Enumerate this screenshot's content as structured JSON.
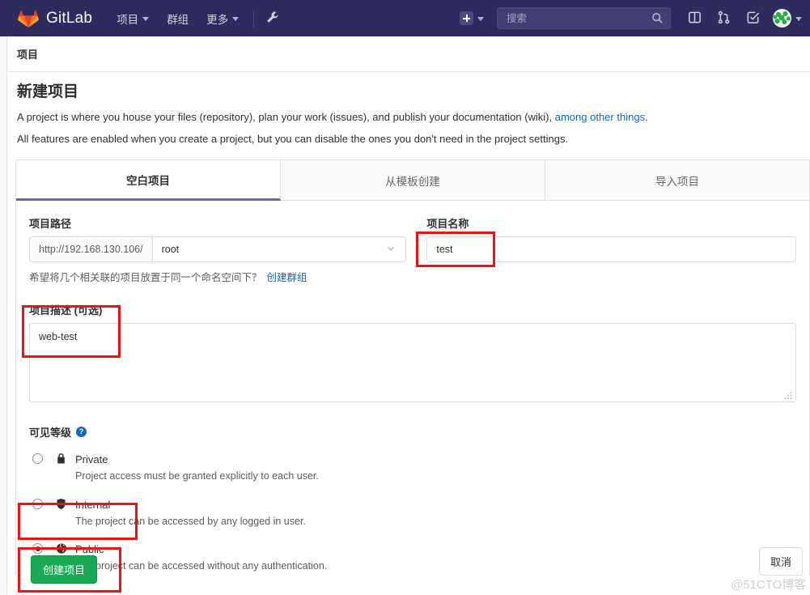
{
  "navbar": {
    "brand": "GitLab",
    "logo_icon": "gitlab-fox-logo",
    "links": [
      {
        "label": "项目",
        "icon": "chevron-down-icon"
      },
      {
        "label": "群组",
        "icon": ""
      },
      {
        "label": "更多",
        "icon": "chevron-down-icon"
      }
    ],
    "admin_icon": "wrench-icon",
    "new_icon": "plus-square-icon",
    "new_caret_icon": "chevron-down-icon",
    "search": {
      "placeholder": "搜索",
      "value": "",
      "icon": "search-icon"
    },
    "issues_icon": "issues-icon",
    "merge_requests_icon": "merge-request-icon",
    "todos_icon": "todo-check-icon",
    "avatar_icon": "user-avatar",
    "avatar_caret_icon": "chevron-down-icon"
  },
  "breadcrumb": {
    "label": "项目"
  },
  "page": {
    "title": "新建项目",
    "desc1_pre": "A project is where you house your files (repository), plan your work (issues), and publish your documentation (wiki), ",
    "desc1_link": "among other things",
    "desc1_post": ".",
    "desc2": "All features are enabled when you create a project, but you can disable the ones you don't need in the project settings."
  },
  "tabs": [
    {
      "label": "空白项目",
      "active": true
    },
    {
      "label": "从模板创建",
      "active": false
    },
    {
      "label": "导入项目",
      "active": false
    }
  ],
  "form": {
    "path_label": "项目路径",
    "path_prefix": "http://192.168.130.106/",
    "namespace_value": "root",
    "namespace_caret_icon": "chevron-down-icon",
    "helper_text": "希望将几个相关联的项目放置于同一个命名空间下？",
    "helper_link": "创建群组",
    "name_label": "项目名称",
    "name_value": "test",
    "desc_label": "项目描述 (可选)",
    "desc_value": "web-test",
    "resize_icon": "resize-grip-icon"
  },
  "visibility": {
    "title": "可见等级",
    "help_icon": "question-mark-icon",
    "help_glyph": "?",
    "options": [
      {
        "name": "Private",
        "desc": "Project access must be granted explicitly to each user.",
        "icon": "lock-icon",
        "selected": false
      },
      {
        "name": "Internal",
        "desc": "The project can be accessed by any logged in user.",
        "icon": "shield-icon",
        "selected": false
      },
      {
        "name": "Public",
        "desc": "The project can be accessed without any authentication.",
        "icon": "globe-icon",
        "selected": true
      }
    ]
  },
  "footer": {
    "create_label": "创建项目",
    "cancel_label": "取消"
  },
  "watermark": "@51CTO博客",
  "colors": {
    "navbar": "#2e2b5e",
    "primary_green": "#1aaa55",
    "link_blue": "#1068bf",
    "tab_underline": "#6b67b5",
    "annotation_red": "#ee1111"
  }
}
